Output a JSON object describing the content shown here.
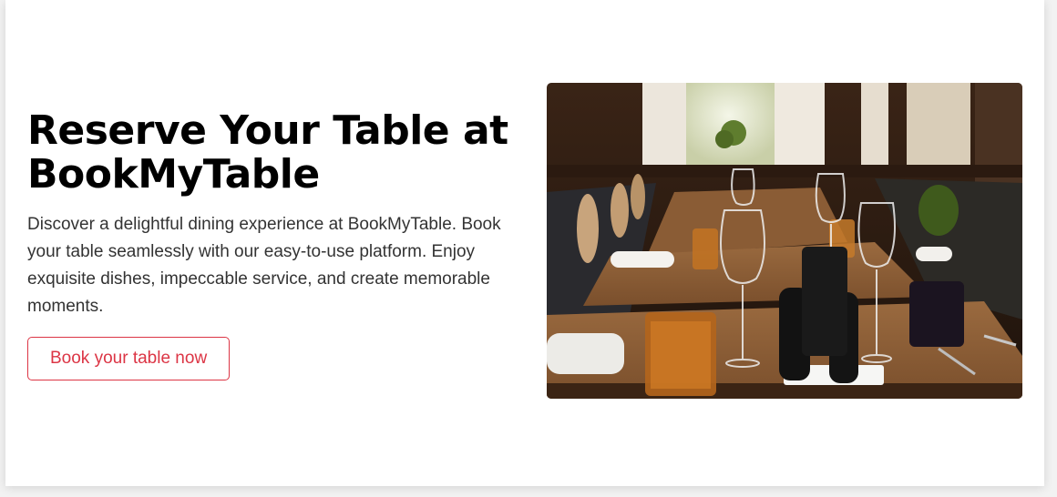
{
  "hero": {
    "title": "Reserve Your Table at BookMyTable",
    "description": "Discover a delightful dining experience at BookMyTable. Book your table seamlessly with our easy-to-use platform. Enjoy exquisite dishes, impeccable service, and create memorable moments.",
    "cta_label": "Book your table now",
    "image_subject": "restaurant dining room with set tables"
  },
  "colors": {
    "accent": "#dc3545",
    "title": "#000000",
    "text": "#333333",
    "background": "#ffffff"
  }
}
